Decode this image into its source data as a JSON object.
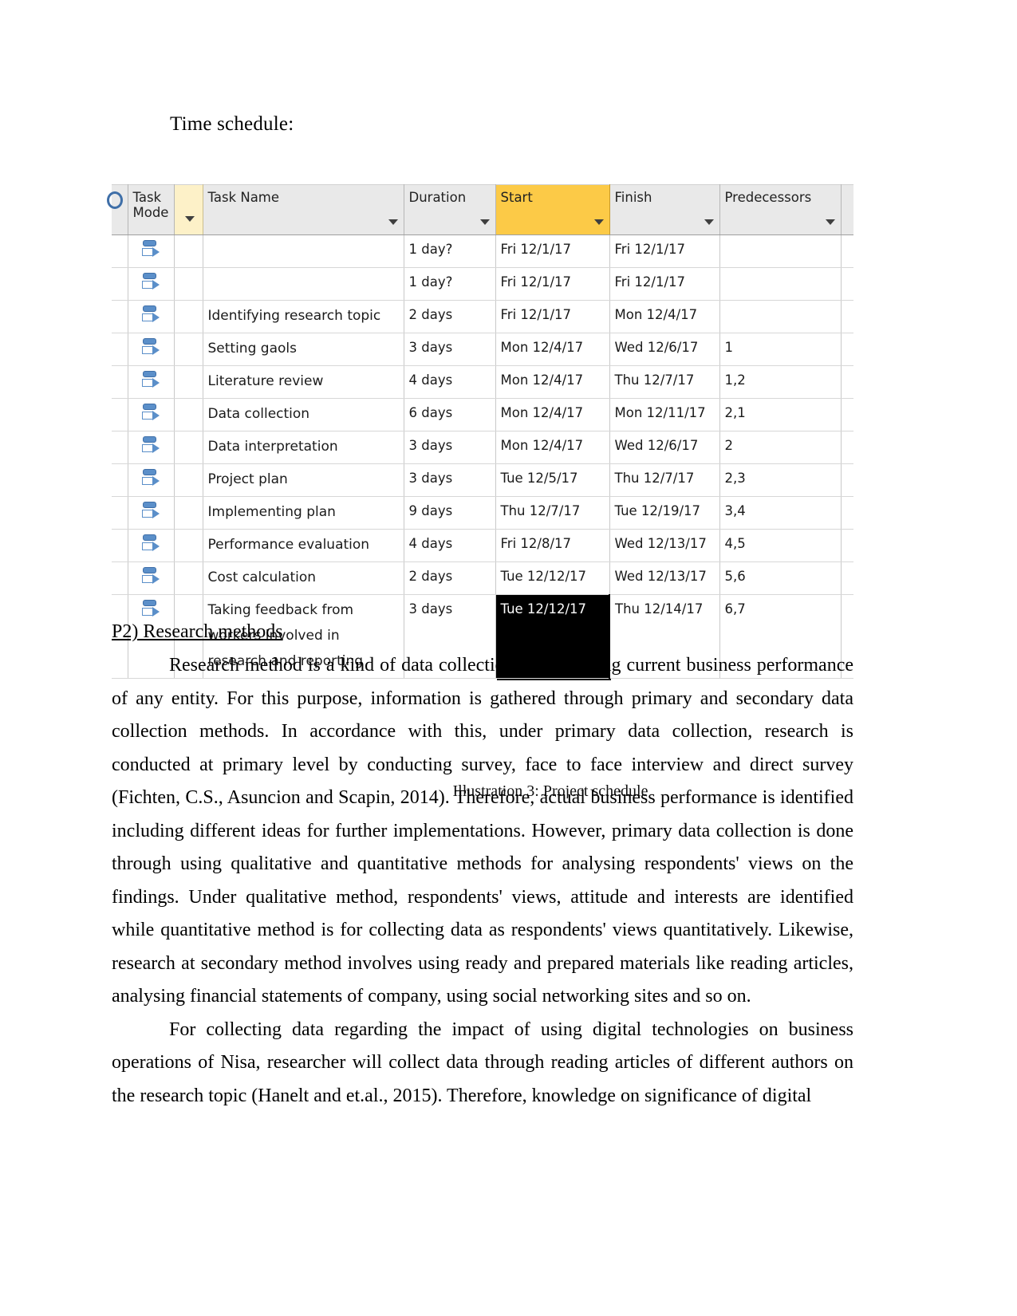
{
  "document": {
    "intro_heading": "Time schedule:",
    "figure_caption": "Illustration 3: Project schedule",
    "section_heading": "P2) Research methods",
    "paragraphs": [
      "Research method is a kind of data collection for analysing current business performance of any entity. For this purpose, information is gathered through primary and secondary data collection methods. In accordance with this, under primary data collection, research is conducted at primary level by conducting survey, face to face interview and direct survey (Fichten, C.S., Asuncion and Scapin, 2014). Therefore, actual business performance is identified including different ideas for further implementations. However, primary data collection is done through using qualitative and quantitative methods for analysing respondents' views on the findings. Under qualitative method, respondents' views, attitude and interests are identified while quantitative method is for collecting data as respondents' views quantitatively. Likewise, research at secondary method involves using ready and prepared materials like reading articles, analysing financial statements of company, using social networking sites and so on.",
      "For collecting data regarding the impact of using digital technologies on business operations of Nisa, researcher will collect data through reading articles of different authors on the research topic (Hanelt and et.al., 2015). Therefore, knowledge on significance of digital"
    ]
  },
  "gantt": {
    "columns": [
      {
        "key": "indicator",
        "label": ""
      },
      {
        "key": "task_mode",
        "label": "Task Mode"
      },
      {
        "key": "flag",
        "label": ""
      },
      {
        "key": "task_name",
        "label": "Task Name"
      },
      {
        "key": "duration",
        "label": "Duration"
      },
      {
        "key": "start",
        "label": "Start"
      },
      {
        "key": "finish",
        "label": "Finish"
      },
      {
        "key": "predecessors",
        "label": "Predecessors"
      }
    ],
    "highlighted_column": "Start",
    "highlight_color": "#fcca47",
    "header_background": "#e9e9e9",
    "selected_cell": {
      "row": 11,
      "column": "start",
      "value": "Tue 12/12/17",
      "background": "#000000",
      "text_color": "#ffffff"
    },
    "rows": [
      {
        "task_name": "",
        "duration": "1 day?",
        "start": "Fri 12/1/17",
        "finish": "Fri 12/1/17",
        "predecessors": ""
      },
      {
        "task_name": "",
        "duration": "1 day?",
        "start": "Fri 12/1/17",
        "finish": "Fri 12/1/17",
        "predecessors": ""
      },
      {
        "task_name": "Identifying research topic",
        "duration": "2 days",
        "start": "Fri 12/1/17",
        "finish": "Mon 12/4/17",
        "predecessors": ""
      },
      {
        "task_name": "Setting gaols",
        "duration": "3 days",
        "start": "Mon 12/4/17",
        "finish": "Wed 12/6/17",
        "predecessors": "1"
      },
      {
        "task_name": "Literature review",
        "duration": "4 days",
        "start": "Mon 12/4/17",
        "finish": "Thu 12/7/17",
        "predecessors": "1,2"
      },
      {
        "task_name": "Data collection",
        "duration": "6 days",
        "start": "Mon 12/4/17",
        "finish": "Mon 12/11/17",
        "predecessors": "2,1"
      },
      {
        "task_name": "Data interpretation",
        "duration": "3 days",
        "start": "Mon 12/4/17",
        "finish": "Wed 12/6/17",
        "predecessors": "2"
      },
      {
        "task_name": "Project plan",
        "duration": "3 days",
        "start": "Tue 12/5/17",
        "finish": "Thu 12/7/17",
        "predecessors": "2,3"
      },
      {
        "task_name": "Implementing plan",
        "duration": "9 days",
        "start": "Thu 12/7/17",
        "finish": "Tue 12/19/17",
        "predecessors": "3,4"
      },
      {
        "task_name": "Performance evaluation",
        "duration": "4 days",
        "start": "Fri 12/8/17",
        "finish": "Wed 12/13/17",
        "predecessors": "4,5"
      },
      {
        "task_name": "Cost calculation",
        "duration": "2 days",
        "start": "Tue 12/12/17",
        "finish": "Wed 12/13/17",
        "predecessors": "5,6"
      },
      {
        "task_name": "Taking feedback from workers involved in research and reporting",
        "duration": "3 days",
        "start": "Tue 12/12/17",
        "finish": "Thu 12/14/17",
        "predecessors": "6,7"
      }
    ]
  }
}
